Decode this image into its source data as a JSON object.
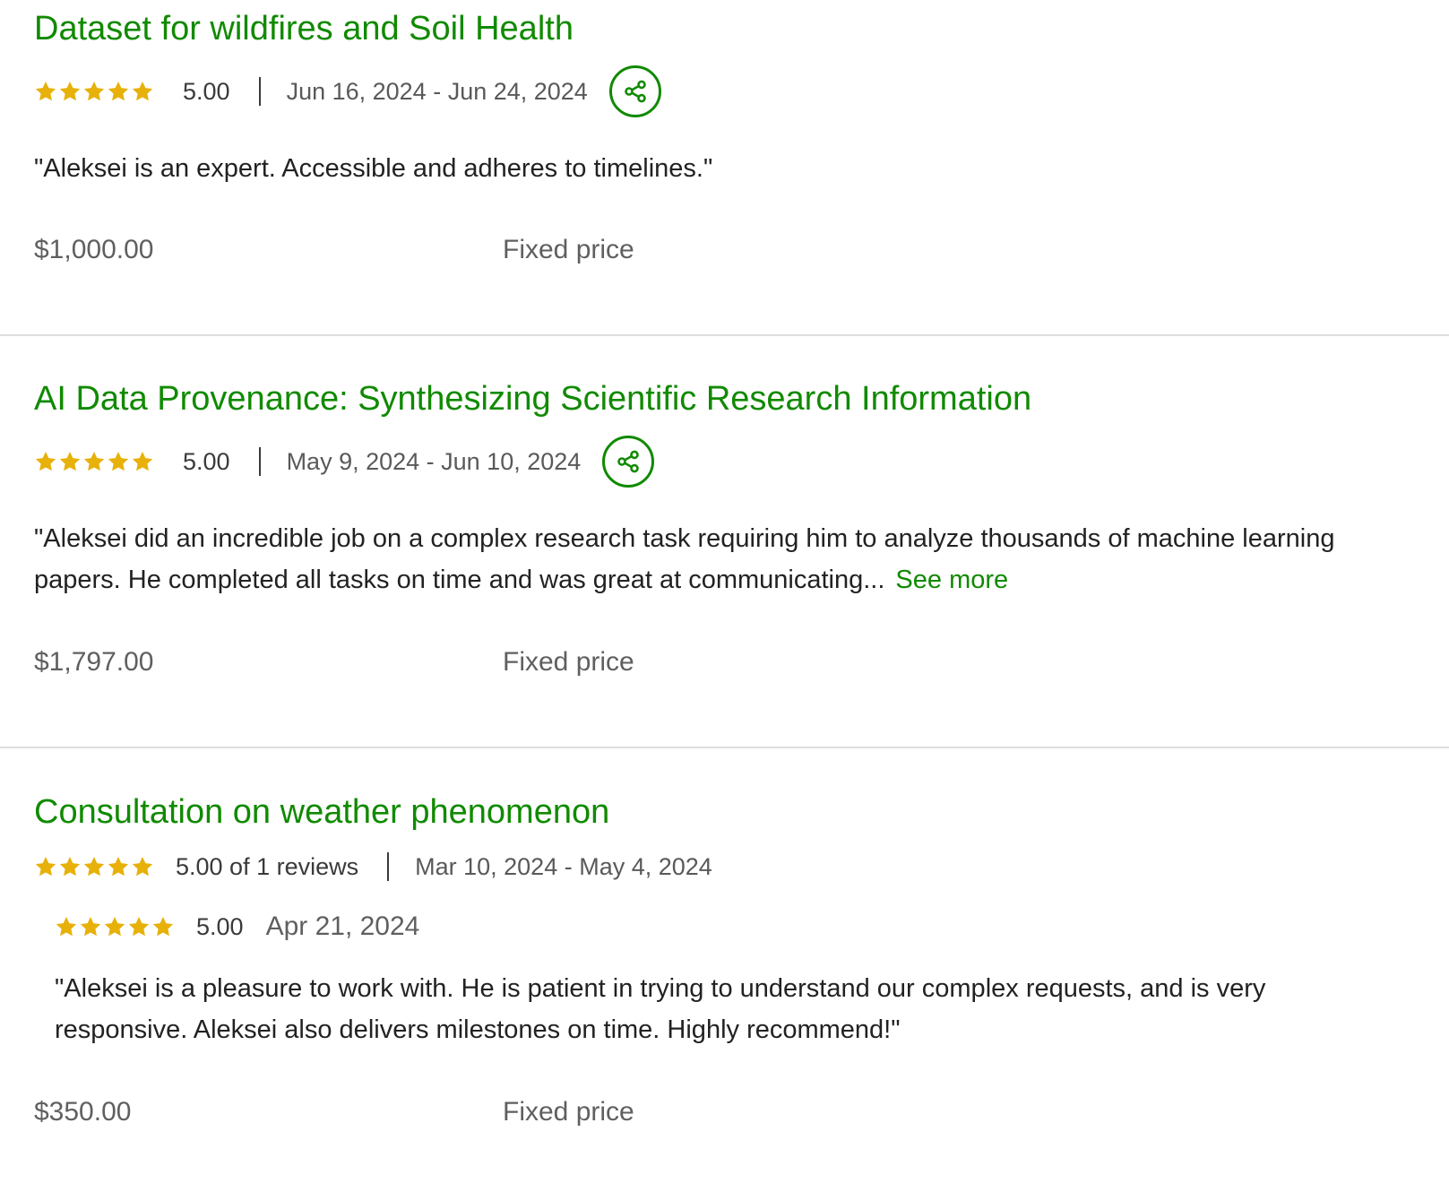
{
  "colors": {
    "accent": "#108a00",
    "star": "#e7b10a",
    "text": "#222222",
    "muted": "#5f5f5f",
    "divider": "#dedede"
  },
  "icons": {
    "star": "star-icon",
    "share": "share-icon"
  },
  "jobs": [
    {
      "title": "Dataset for wildfires and Soil Health",
      "stars": 5,
      "rating": "5.00",
      "dates": "Jun 16, 2024 - Jun 24, 2024",
      "review": "\"Aleksei is an expert. Accessible and adheres to timelines.\"",
      "price": "$1,000.00",
      "price_type": "Fixed price"
    },
    {
      "title": "AI Data Provenance: Synthesizing Scientific Research Information",
      "stars": 5,
      "rating": "5.00",
      "dates": "May 9, 2024 - Jun 10, 2024",
      "review": "\"Aleksei did an incredible job on a complex research task requiring him to analyze thousands of machine learning papers. He completed all tasks on time and was great at communicating...",
      "see_more": "See more",
      "price": "$1,797.00",
      "price_type": "Fixed price"
    },
    {
      "title": "Consultation on weather phenomenon",
      "stars": 5,
      "rating": "5.00 of 1 reviews",
      "dates": "Mar 10, 2024 - May 4, 2024",
      "sub_review": {
        "stars": 5,
        "rating": "5.00",
        "date": "Apr 21, 2024",
        "text": "\"Aleksei is a pleasure to work with. He is patient in trying to understand our complex requests, and is very responsive. Aleksei also delivers milestones on time. Highly recommend!\""
      },
      "price": "$350.00",
      "price_type": "Fixed price"
    }
  ]
}
